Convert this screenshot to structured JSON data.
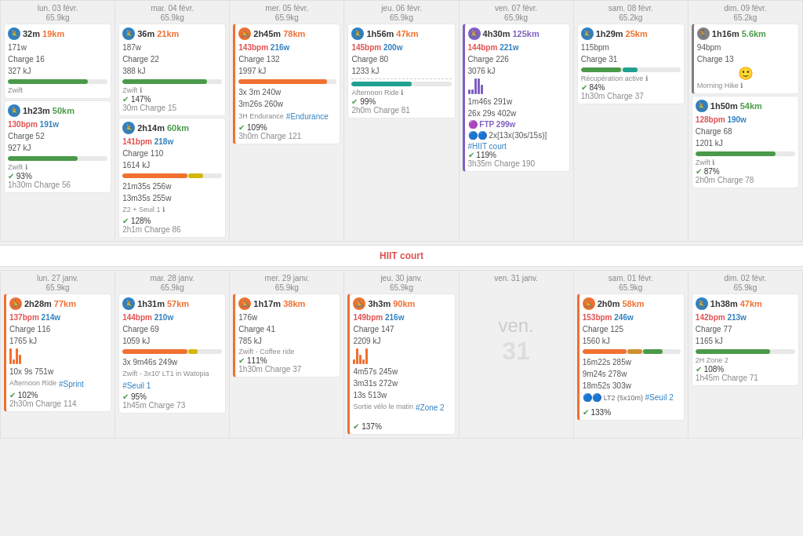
{
  "weeks": [
    {
      "days": [
        {
          "header": "lun. 03 févr.",
          "weight": "65.9kg",
          "activities": [
            {
              "icon": "bike",
              "iconColor": "blue",
              "time": "32m",
              "dist": "19km",
              "distColor": "orange",
              "details": [
                "171w",
                "Charge 16",
                "327 kJ"
              ],
              "bars": [
                {
                  "w": 80,
                  "color": "pb-green"
                }
              ],
              "appLabel": "Zwift",
              "charge_row": null
            },
            {
              "icon": "bike",
              "iconColor": "blue",
              "time": "1h23m",
              "dist": "50km",
              "distColor": "green",
              "details": [
                "130bpm 191w",
                "Charge 52",
                "927 kJ"
              ],
              "bpmColor": true,
              "bars": [
                {
                  "w": 70,
                  "color": "pb-green"
                }
              ],
              "appLabel": "Zwift",
              "checkPercent": "93%",
              "extra": "1h30m Charge 56"
            }
          ]
        },
        {
          "header": "mar. 04 févr.",
          "weight": "65.9kg",
          "activities": [
            {
              "icon": "bike",
              "iconColor": "blue",
              "time": "36m",
              "dist": "21km",
              "distColor": "orange",
              "details": [
                "187w",
                "Charge 22",
                "388 kJ"
              ],
              "bars": [
                {
                  "w": 85,
                  "color": "pb-green"
                }
              ],
              "appLabel": "Zwift",
              "checkPercent": "147%",
              "extra": "30m Charge 15"
            },
            {
              "icon": "bike",
              "iconColor": "blue",
              "time": "2h14m",
              "dist": "60km",
              "distColor": "green",
              "details": [
                "141bpm 218w",
                "Charge 110",
                "1614 kJ"
              ],
              "bpmColor": true,
              "bars": [
                {
                  "w": 75,
                  "color": "pb-orange"
                },
                {
                  "w": 20,
                  "color": "pb-yellow"
                }
              ],
              "multibar": true,
              "extraLines": [
                "21m35s 256w",
                "13m35s 255w",
                "Z2 + Seuil 1"
              ],
              "checkPercent": "128%",
              "extra": "2h1m Charge 86"
            }
          ]
        },
        {
          "header": "mer. 05 févr.",
          "weight": "65.9kg",
          "activities": [
            {
              "icon": "bike",
              "iconColor": "orange",
              "time": "2h45m",
              "dist": "78km",
              "distColor": "orange",
              "distBg": "orange",
              "details": [
                "143bpm 216w",
                "Charge 132",
                "1997 kJ"
              ],
              "bpmColor": true,
              "appLabel": "3x   3m 240w",
              "appLabel2": "3m26s 260w",
              "actName": "3H Endurance #Endurance",
              "checkPercent": "109%",
              "extra": "3h0m Charge 121"
            }
          ]
        },
        {
          "header": "jeu. 06 févr.",
          "weight": "65.9kg",
          "activities": [
            {
              "icon": "bike",
              "iconColor": "blue",
              "time": "1h56m",
              "dist": "47km",
              "distColor": "orange",
              "details": [
                "145bpm 200w",
                "Charge 80",
                "1233 kJ"
              ],
              "bpmColor": true,
              "bars": [
                {
                  "w": 60,
                  "color": "pb-teal"
                }
              ],
              "dotted": true,
              "appLabel": "Afternoon Ride",
              "checkPercent": "99%",
              "extra": "2h0m Charge 81"
            }
          ]
        },
        {
          "header": "ven. 07 févr.",
          "weight": "65.9kg",
          "activities": [
            {
              "icon": "bike",
              "iconColor": "purple",
              "time": "4h30m",
              "dist": "125km",
              "distColor": "purple",
              "details": [
                "144bpm 221w",
                "Charge 226",
                "3076 kJ"
              ],
              "bpmColor": true,
              "sparklines": true,
              "extraLines": [
                "1m46s 291w",
                "26x   29s 402w"
              ],
              "ftpLabel": "FTP 299w",
              "hiitInfo": "2x[13x(30s/15s)]",
              "hashLabel": "#HIIT court",
              "checkPercent": "119%",
              "extra": "3h35m Charge 190"
            }
          ]
        },
        {
          "header": "sam. 08 févr.",
          "weight": "65.2kg",
          "activities": [
            {
              "icon": "bike",
              "iconColor": "blue",
              "time": "1h29m",
              "dist": "25km",
              "distColor": "orange",
              "details": [
                "115bpm",
                "Charge 31"
              ],
              "bars": [
                {
                  "w": 40,
                  "color": "pb-green"
                },
                {
                  "w": 15,
                  "color": "pb-teal"
                }
              ],
              "multibar2": true,
              "appLabel": "Récupération active",
              "checkPercent": "84%",
              "extra": "1h30m Charge 37"
            }
          ]
        },
        {
          "header": "dim. 09 févr.",
          "weight": "65.2kg",
          "activities": [
            {
              "icon": "run",
              "iconColor": "gray",
              "time": "1h16m",
              "dist": "5.6km",
              "distColor": "green",
              "details": [
                "94bpm",
                "Charge 13"
              ],
              "bpmColor": true,
              "emoji": "🙂",
              "appLabel": "Morning Hike",
              "noPercent": true
            },
            {
              "icon": "bike",
              "iconColor": "blue",
              "time": "1h50m",
              "dist": "54km",
              "distColor": "green",
              "details": [
                "128bpm 190w",
                "Charge 68",
                "1201 kJ"
              ],
              "bpmColor": true,
              "bars": [
                {
                  "w": 80,
                  "color": "pb-green"
                }
              ],
              "appLabel": "Zwift",
              "checkPercent": "87%",
              "extra": "2h0m Charge 78"
            }
          ]
        }
      ]
    },
    {
      "days": [
        {
          "header": "lun. 27 janv.",
          "weight": "65.9kg",
          "activities": [
            {
              "icon": "bike",
              "iconColor": "orange",
              "time": "2h28m",
              "dist": "77km",
              "distColor": "orange",
              "details": [
                "137bpm 214w",
                "Charge 116",
                "1765 kJ"
              ],
              "bpmColor": true,
              "sparkMulti": true,
              "extraLines": [
                "10x 9s 751w"
              ],
              "actName": "Afternoon Ride #Sprint",
              "checkPercent": "102%",
              "extra": "2h30m Charge 114"
            }
          ]
        },
        {
          "header": "mar. 28 janv.",
          "weight": "65.9kg",
          "activities": [
            {
              "icon": "bike",
              "iconColor": "blue",
              "time": "1h31m",
              "dist": "57km",
              "distColor": "orange",
              "details": [
                "144bpm 210w",
                "Charge 69",
                "1059 kJ"
              ],
              "bpmColor": true,
              "bars": [
                {
                  "w": 70,
                  "color": "pb-orange"
                },
                {
                  "w": 10,
                  "color": "pb-yellow"
                }
              ],
              "multibar": true,
              "extraLines": [
                "3x 9m46s 249w"
              ],
              "actName": "Zwift - 3x10' LT1 in Watopia",
              "hashLabel": "#Seuil 1",
              "checkPercent": "95%",
              "extra": "1h45m Charge 73"
            }
          ]
        },
        {
          "header": "mer. 29 janv.",
          "weight": "65.9kg",
          "activities": [
            {
              "icon": "bike",
              "iconColor": "orange",
              "time": "1h17m",
              "dist": "38km",
              "distColor": "orange",
              "details": [
                "176w",
                "Charge 41",
                "785 kJ"
              ],
              "appLabel": "Zwift - Coffee ride",
              "checkPercent": "111%",
              "extra": "1h30m Charge 37"
            }
          ]
        },
        {
          "header": "jeu. 30 janv.",
          "weight": "65.9kg",
          "activities": [
            {
              "icon": "bike",
              "iconColor": "orange",
              "time": "3h3m",
              "dist": "90km",
              "distColor": "orange",
              "details": [
                "149bpm 216w",
                "Charge 147",
                "2209 kJ"
              ],
              "bpmColor": true,
              "bars2seg": true,
              "extraLines": [
                "4m57s 245w",
                "3m31s 272w",
                "13s 513w"
              ],
              "actName": "Sortie vélo le matin #Zone 2",
              "checkPercent": "137%",
              "noExtra": true
            }
          ]
        },
        {
          "header": "ven. 31 janv.",
          "weight": "",
          "activities": [
            {
              "empty": true,
              "label": "ven.",
              "num": "31"
            }
          ]
        },
        {
          "header": "sam. 01 févr.",
          "weight": "65.9kg",
          "activities": [
            {
              "icon": "bike",
              "iconColor": "orange",
              "time": "2h0m",
              "dist": "58km",
              "distColor": "orange",
              "details": [
                "153bpm 246w",
                "Charge 125",
                "1560 kJ"
              ],
              "bpmColor": true,
              "multiBarThree": true,
              "extraLines": [
                "16m22s 285w",
                "9m24s 278w",
                "18m52s 303w"
              ],
              "hiitInfo2": "LT2 (5x10m) #Seuil 2",
              "checkPercent": "133%",
              "noExtra": true
            }
          ]
        },
        {
          "header": "dim. 02 févr.",
          "weight": "65.9kg",
          "activities": [
            {
              "icon": "bike",
              "iconColor": "blue",
              "time": "1h38m",
              "dist": "47km",
              "distColor": "orange",
              "details": [
                "142bpm 213w",
                "Charge 77",
                "1165 kJ"
              ],
              "bpmColor": true,
              "appLabel": "2H Zone 2",
              "checkPercent": "108%",
              "extra": "1h45m Charge 71"
            }
          ]
        }
      ]
    }
  ],
  "hiit_label": "HIIT court",
  "icons": {
    "bike": "🚴",
    "run": "🚶",
    "check": "✔",
    "info": "ℹ"
  }
}
